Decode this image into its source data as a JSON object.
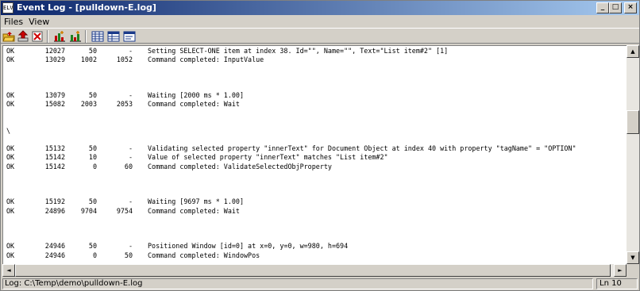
{
  "window": {
    "title": "Event Log - [pulldown-E.log]",
    "icon_text": "ELV"
  },
  "title_buttons": {
    "minimize": "_",
    "maximize": "□",
    "close": "×"
  },
  "menu": [
    {
      "label": "Files"
    },
    {
      "label": "View"
    }
  ],
  "toolbar": {
    "icons": [
      "open-folder-icon",
      "upload-icon",
      "delete-icon",
      "bar-chart-icon",
      "bar-chart-alt-icon",
      "grid-view-icon",
      "table-view-icon",
      "list-view-icon"
    ]
  },
  "log_lines": [
    {
      "status": "OK",
      "time": "12027",
      "dur": "50",
      "total": "-",
      "msg": "Setting SELECT-ONE item at index 38. Id=\"\", Name=\"\", Text=\"List item#2\" [1]"
    },
    {
      "status": "OK",
      "time": "13029",
      "dur": "1002",
      "total": "1052",
      "msg": "Command completed: InputValue"
    },
    {
      "status": "",
      "time": "",
      "dur": "",
      "total": "",
      "msg": ""
    },
    {
      "status": "",
      "time": "",
      "dur": "",
      "total": "",
      "msg": ""
    },
    {
      "status": "",
      "time": "",
      "dur": "",
      "total": "",
      "msg": ""
    },
    {
      "status": "OK",
      "time": "13079",
      "dur": "50",
      "total": "-",
      "msg": "Waiting [2000 ms * 1.00]"
    },
    {
      "status": "OK",
      "time": "15082",
      "dur": "2003",
      "total": "2053",
      "msg": "Command completed: Wait"
    },
    {
      "status": "",
      "time": "",
      "dur": "",
      "total": "",
      "msg": ""
    },
    {
      "status": "",
      "time": "",
      "dur": "",
      "total": "",
      "msg": ""
    },
    {
      "status": "\\",
      "time": "",
      "dur": "",
      "total": "",
      "msg": ""
    },
    {
      "status": "",
      "time": "",
      "dur": "",
      "total": "",
      "msg": ""
    },
    {
      "status": "OK",
      "time": "15132",
      "dur": "50",
      "total": "-",
      "msg": "Validating selected property \"innerText\" for Document Object at index 40 with property \"tagName\" = \"OPTION\""
    },
    {
      "status": "OK",
      "time": "15142",
      "dur": "10",
      "total": "-",
      "msg": "Value of selected property \"innerText\" matches \"List item#2\""
    },
    {
      "status": "OK",
      "time": "15142",
      "dur": "0",
      "total": "60",
      "msg": "Command completed: ValidateSelectedObjProperty"
    },
    {
      "status": "",
      "time": "",
      "dur": "",
      "total": "",
      "msg": ""
    },
    {
      "status": "",
      "time": "",
      "dur": "",
      "total": "",
      "msg": ""
    },
    {
      "status": "",
      "time": "",
      "dur": "",
      "total": "",
      "msg": ""
    },
    {
      "status": "OK",
      "time": "15192",
      "dur": "50",
      "total": "-",
      "msg": "Waiting [9697 ms * 1.00]"
    },
    {
      "status": "OK",
      "time": "24896",
      "dur": "9704",
      "total": "9754",
      "msg": "Command completed: Wait"
    },
    {
      "status": "",
      "time": "",
      "dur": "",
      "total": "",
      "msg": ""
    },
    {
      "status": "",
      "time": "",
      "dur": "",
      "total": "",
      "msg": ""
    },
    {
      "status": "",
      "time": "",
      "dur": "",
      "total": "",
      "msg": ""
    },
    {
      "status": "OK",
      "time": "24946",
      "dur": "50",
      "total": "-",
      "msg": "Positioned Window [id=0] at x=0, y=0, w=980, h=694"
    },
    {
      "status": "OK",
      "time": "24946",
      "dur": "0",
      "total": "50",
      "msg": "Command completed: WindowPos"
    }
  ],
  "scrollbar": {
    "up": "▲",
    "down": "▼",
    "left": "◄",
    "right": "►"
  },
  "status": {
    "path": "Log: C:\\Temp\\demo\\pulldown-E.log",
    "line": "Ln 10"
  }
}
